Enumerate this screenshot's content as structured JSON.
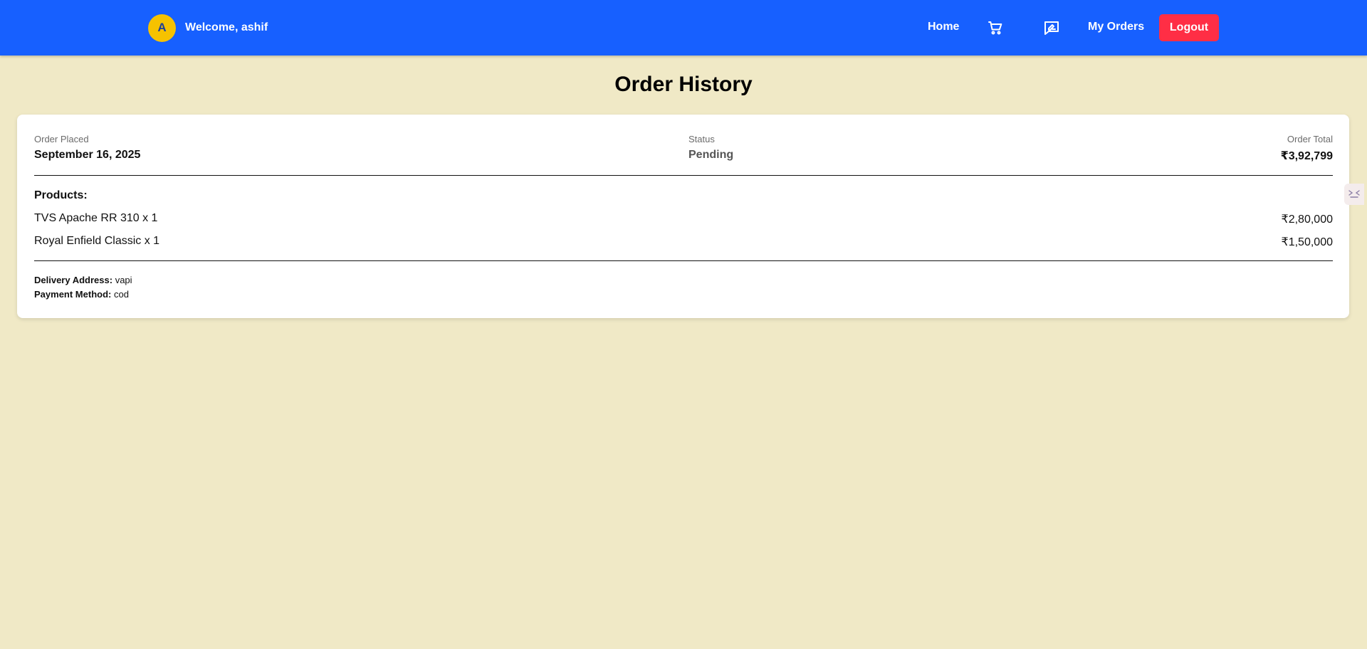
{
  "navbar": {
    "avatar_initial": "A",
    "welcome_text": "Welcome, ashif",
    "home_label": "Home",
    "cart_icon": "cart-icon",
    "feedback_icon": "feedback-icon",
    "my_orders_label": "My Orders",
    "logout_label": "Logout",
    "brand_color": "#1760ff",
    "logout_color": "#ff2e45",
    "avatar_color": "#f6c200"
  },
  "page": {
    "title": "Order History",
    "background_color": "#f0e9c6"
  },
  "order": {
    "placed_label": "Order Placed",
    "placed_value": "September 16, 2025",
    "status_label": "Status",
    "status_value": "Pending",
    "total_label": "Order Total",
    "total_value": "₹3,92,799",
    "products_heading": "Products:",
    "products": [
      {
        "name": "TVS Apache RR 310 x 1",
        "price": "₹2,80,000"
      },
      {
        "name": "Royal Enfield Classic x 1",
        "price": "₹1,50,000"
      }
    ],
    "delivery_label": "Delivery Address:",
    "delivery_value": "vapi",
    "payment_label": "Payment Method:",
    "payment_value": "cod"
  },
  "side_tab": {
    "icon": "collapse-arrows-icon"
  }
}
